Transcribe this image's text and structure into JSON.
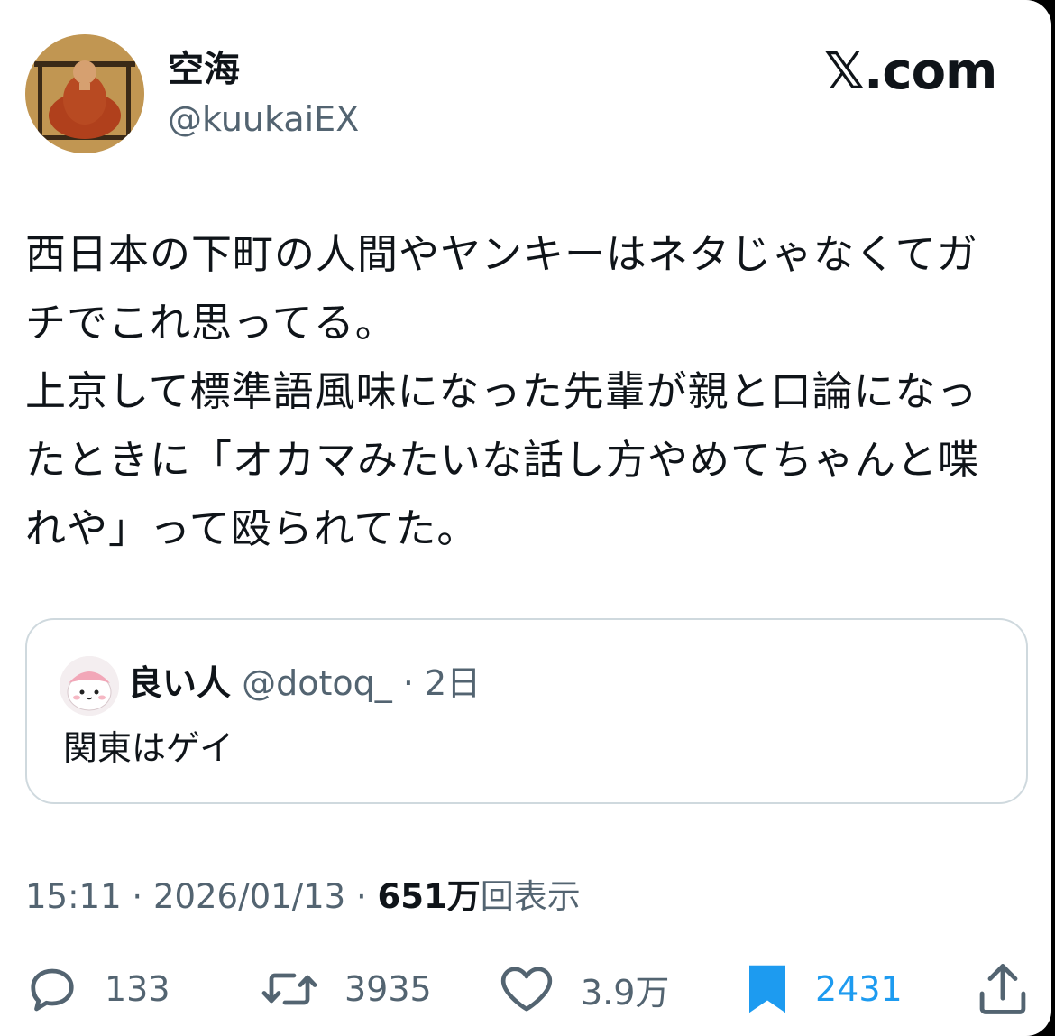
{
  "author": {
    "display_name": "空海",
    "handle": "@kuukaiEX",
    "avatar_icon": "avatar-portrait"
  },
  "brand": "𝕏.com",
  "tweet": {
    "lines": [
      "西日本の下町の人間やヤンキーはネタじゃなくてガ",
      "チでこれ思ってる。",
      "上京して標準語風味になった先輩が親と口論になっ",
      "たときに「オカマみたいな話し方やめてちゃんと喋",
      "れや」って殴られてた。"
    ]
  },
  "quote": {
    "name": "良い人",
    "handle": "@dotoq_",
    "sep": "·",
    "time": "2日",
    "text": "関東はゲイ"
  },
  "meta": {
    "time": "15:11",
    "sep1": " · ",
    "date": "2026/01/13",
    "sep2": " · ",
    "views": "651万",
    "views_label": "回表示"
  },
  "actions": {
    "reply_count": "133",
    "retweet_count": "3935",
    "like_count": "3.9万",
    "bookmark_count": "2431"
  },
  "colors": {
    "text": "#0f1419",
    "secondary": "#536471",
    "accent": "#1d9bf0",
    "border": "#cfd9de"
  }
}
